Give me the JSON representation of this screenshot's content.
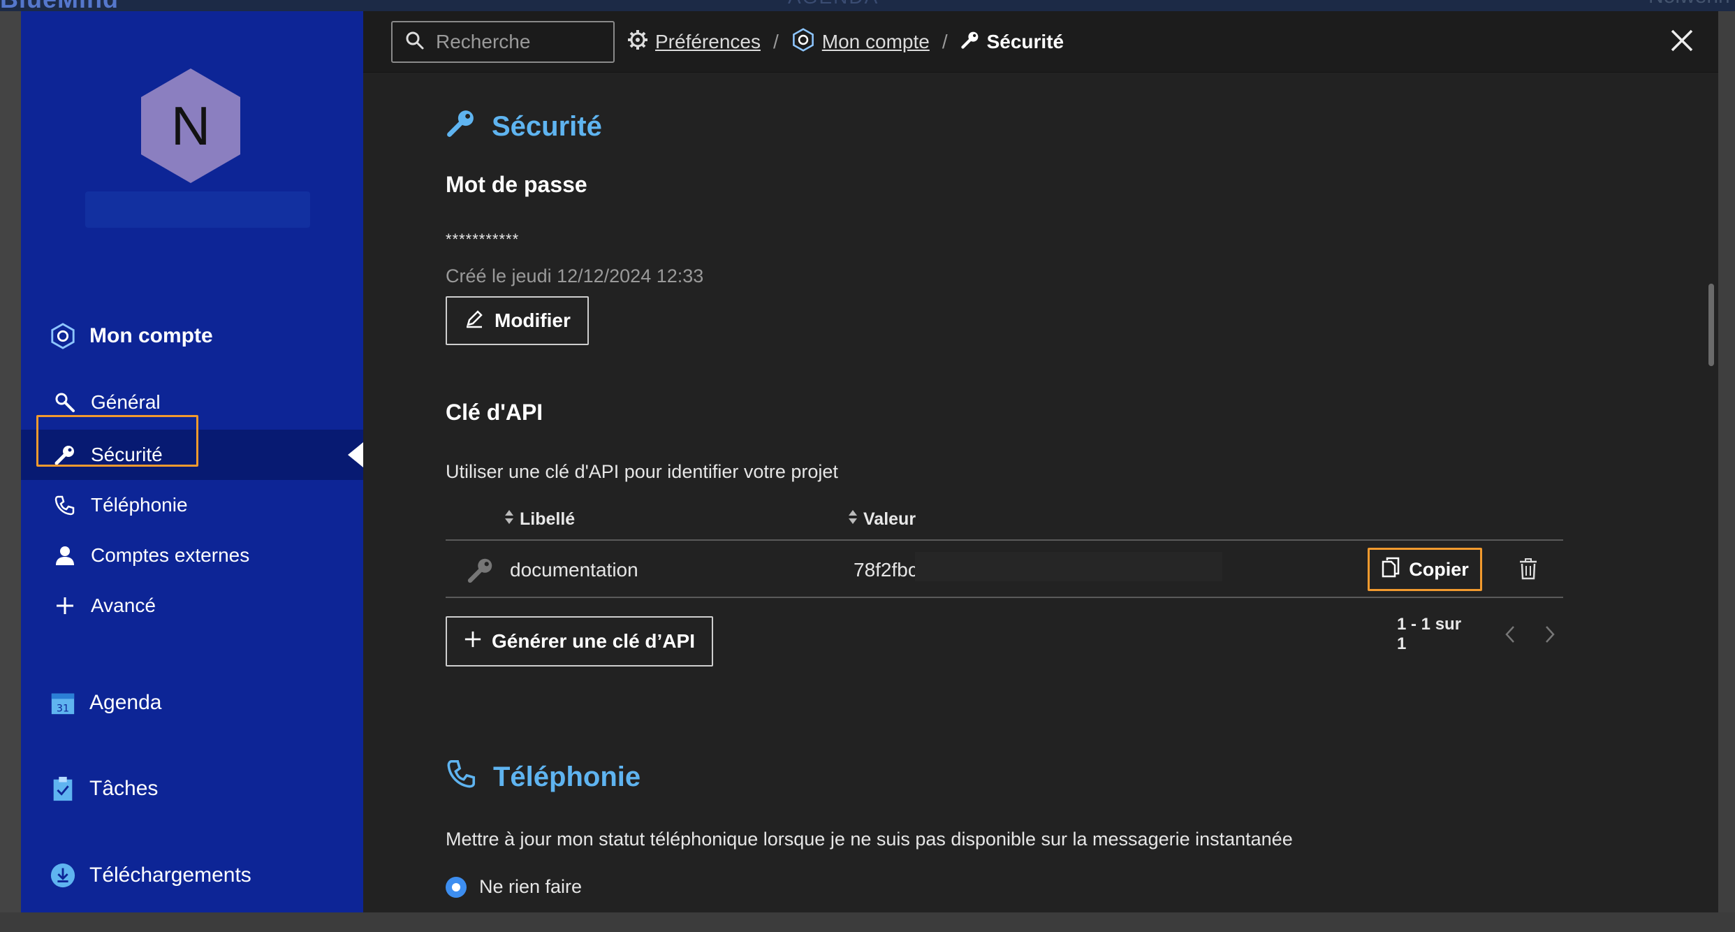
{
  "background": {
    "logo": "BlueMind",
    "center_label": "AGENDA",
    "user": "Nolwenn"
  },
  "sidebar": {
    "avatar_letter": "N",
    "sections": [
      {
        "label": "Mon compte",
        "icon": "account-hexagon-icon"
      },
      {
        "label": "Agenda",
        "icon": "calendar-icon"
      },
      {
        "label": "Tâches",
        "icon": "tasks-clipboard-icon"
      },
      {
        "label": "Téléchargements",
        "icon": "download-icon"
      }
    ],
    "items": [
      {
        "label": "Général",
        "icon": "wrench-icon"
      },
      {
        "label": "Sécurité",
        "icon": "key-icon",
        "active": true
      },
      {
        "label": "Téléphonie",
        "icon": "phone-icon"
      },
      {
        "label": "Comptes externes",
        "icon": "user-icon"
      },
      {
        "label": "Avancé",
        "icon": "plus-icon"
      }
    ],
    "colors": {
      "background": "#0d2596",
      "active": "#071a72",
      "highlight": "#f29a2e"
    }
  },
  "topbar": {
    "search_placeholder": "Recherche",
    "breadcrumb": [
      {
        "label": "Préférences",
        "icon": "gear-icon"
      },
      {
        "label": "Mon compte",
        "icon": "account-hexagon-icon"
      },
      {
        "label": "Sécurité",
        "icon": "key-icon"
      }
    ],
    "separator": "/"
  },
  "security": {
    "title": "Sécurité",
    "password": {
      "heading": "Mot de passe",
      "masked": "***********",
      "created": "Créé le jeudi 12/12/2024 12:33",
      "edit_label": "Modifier"
    },
    "api": {
      "heading": "Clé d'API",
      "description": "Utiliser une clé d'API pour identifier votre projet",
      "columns": [
        "Libellé",
        "Valeur"
      ],
      "rows": [
        {
          "label": "documentation",
          "value": "78f2fbc",
          "copy_label": "Copier"
        }
      ],
      "generate_label": "Générer une clé d’API",
      "pagination": "1 - 1 sur 1"
    }
  },
  "telephony": {
    "title": "Téléphonie",
    "description": "Mettre à jour mon statut téléphonique lorsque je ne suis pas disponible sur la messagerie instantanée",
    "option_selected": "Ne rien faire"
  },
  "colors": {
    "accent": "#5fb4f0",
    "panel": "#222222",
    "radio": "#3d8ef0"
  }
}
